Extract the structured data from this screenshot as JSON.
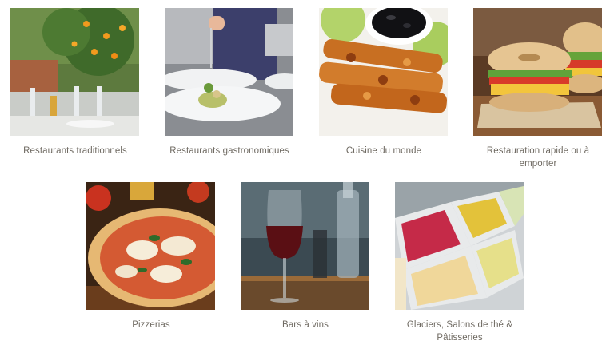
{
  "categories": [
    {
      "id": "traditionnels",
      "label": "Restaurants traditionnels",
      "image": "restaurant-terrace-photo"
    },
    {
      "id": "gastronomiques",
      "label": "Restaurants gastronomiques",
      "image": "chef-plating-photo"
    },
    {
      "id": "monde",
      "label": "Cuisine du monde",
      "image": "grilled-chicken-skewers-photo"
    },
    {
      "id": "rapide",
      "label": "Restauration rapide ou à emporter",
      "image": "bagel-sandwich-photo"
    },
    {
      "id": "pizzerias",
      "label": "Pizzerias",
      "image": "pizza-photo"
    },
    {
      "id": "bars-vins",
      "label": "Bars à vins",
      "image": "red-wine-glass-photo"
    },
    {
      "id": "glaciers",
      "label": "Glaciers, Salons de thé & Pâtisseries",
      "image": "ice-cream-display-photo"
    }
  ]
}
